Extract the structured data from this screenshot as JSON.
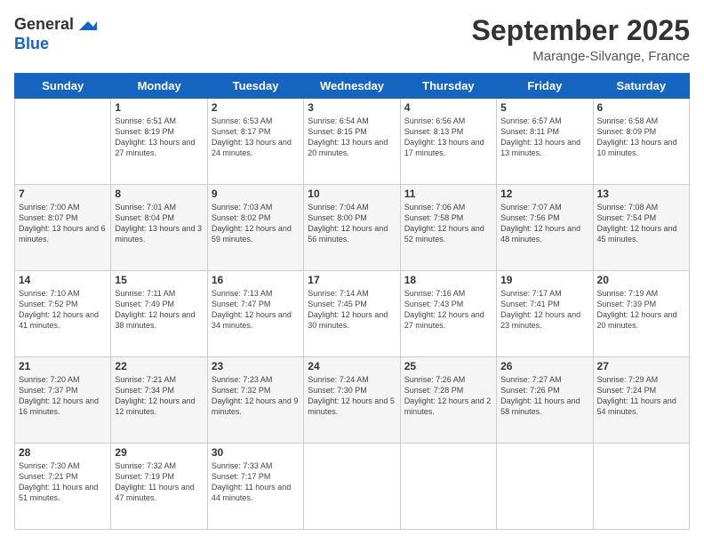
{
  "header": {
    "logo_line1": "General",
    "logo_line2": "Blue",
    "month": "September 2025",
    "location": "Marange-Silvange, France"
  },
  "days_of_week": [
    "Sunday",
    "Monday",
    "Tuesday",
    "Wednesday",
    "Thursday",
    "Friday",
    "Saturday"
  ],
  "weeks": [
    [
      {
        "day": "",
        "sunrise": "",
        "sunset": "",
        "daylight": ""
      },
      {
        "day": "1",
        "sunrise": "Sunrise: 6:51 AM",
        "sunset": "Sunset: 8:19 PM",
        "daylight": "Daylight: 13 hours and 27 minutes."
      },
      {
        "day": "2",
        "sunrise": "Sunrise: 6:53 AM",
        "sunset": "Sunset: 8:17 PM",
        "daylight": "Daylight: 13 hours and 24 minutes."
      },
      {
        "day": "3",
        "sunrise": "Sunrise: 6:54 AM",
        "sunset": "Sunset: 8:15 PM",
        "daylight": "Daylight: 13 hours and 20 minutes."
      },
      {
        "day": "4",
        "sunrise": "Sunrise: 6:56 AM",
        "sunset": "Sunset: 8:13 PM",
        "daylight": "Daylight: 13 hours and 17 minutes."
      },
      {
        "day": "5",
        "sunrise": "Sunrise: 6:57 AM",
        "sunset": "Sunset: 8:11 PM",
        "daylight": "Daylight: 13 hours and 13 minutes."
      },
      {
        "day": "6",
        "sunrise": "Sunrise: 6:58 AM",
        "sunset": "Sunset: 8:09 PM",
        "daylight": "Daylight: 13 hours and 10 minutes."
      }
    ],
    [
      {
        "day": "7",
        "sunrise": "Sunrise: 7:00 AM",
        "sunset": "Sunset: 8:07 PM",
        "daylight": "Daylight: 13 hours and 6 minutes."
      },
      {
        "day": "8",
        "sunrise": "Sunrise: 7:01 AM",
        "sunset": "Sunset: 8:04 PM",
        "daylight": "Daylight: 13 hours and 3 minutes."
      },
      {
        "day": "9",
        "sunrise": "Sunrise: 7:03 AM",
        "sunset": "Sunset: 8:02 PM",
        "daylight": "Daylight: 12 hours and 59 minutes."
      },
      {
        "day": "10",
        "sunrise": "Sunrise: 7:04 AM",
        "sunset": "Sunset: 8:00 PM",
        "daylight": "Daylight: 12 hours and 56 minutes."
      },
      {
        "day": "11",
        "sunrise": "Sunrise: 7:06 AM",
        "sunset": "Sunset: 7:58 PM",
        "daylight": "Daylight: 12 hours and 52 minutes."
      },
      {
        "day": "12",
        "sunrise": "Sunrise: 7:07 AM",
        "sunset": "Sunset: 7:56 PM",
        "daylight": "Daylight: 12 hours and 48 minutes."
      },
      {
        "day": "13",
        "sunrise": "Sunrise: 7:08 AM",
        "sunset": "Sunset: 7:54 PM",
        "daylight": "Daylight: 12 hours and 45 minutes."
      }
    ],
    [
      {
        "day": "14",
        "sunrise": "Sunrise: 7:10 AM",
        "sunset": "Sunset: 7:52 PM",
        "daylight": "Daylight: 12 hours and 41 minutes."
      },
      {
        "day": "15",
        "sunrise": "Sunrise: 7:11 AM",
        "sunset": "Sunset: 7:49 PM",
        "daylight": "Daylight: 12 hours and 38 minutes."
      },
      {
        "day": "16",
        "sunrise": "Sunrise: 7:13 AM",
        "sunset": "Sunset: 7:47 PM",
        "daylight": "Daylight: 12 hours and 34 minutes."
      },
      {
        "day": "17",
        "sunrise": "Sunrise: 7:14 AM",
        "sunset": "Sunset: 7:45 PM",
        "daylight": "Daylight: 12 hours and 30 minutes."
      },
      {
        "day": "18",
        "sunrise": "Sunrise: 7:16 AM",
        "sunset": "Sunset: 7:43 PM",
        "daylight": "Daylight: 12 hours and 27 minutes."
      },
      {
        "day": "19",
        "sunrise": "Sunrise: 7:17 AM",
        "sunset": "Sunset: 7:41 PM",
        "daylight": "Daylight: 12 hours and 23 minutes."
      },
      {
        "day": "20",
        "sunrise": "Sunrise: 7:19 AM",
        "sunset": "Sunset: 7:39 PM",
        "daylight": "Daylight: 12 hours and 20 minutes."
      }
    ],
    [
      {
        "day": "21",
        "sunrise": "Sunrise: 7:20 AM",
        "sunset": "Sunset: 7:37 PM",
        "daylight": "Daylight: 12 hours and 16 minutes."
      },
      {
        "day": "22",
        "sunrise": "Sunrise: 7:21 AM",
        "sunset": "Sunset: 7:34 PM",
        "daylight": "Daylight: 12 hours and 12 minutes."
      },
      {
        "day": "23",
        "sunrise": "Sunrise: 7:23 AM",
        "sunset": "Sunset: 7:32 PM",
        "daylight": "Daylight: 12 hours and 9 minutes."
      },
      {
        "day": "24",
        "sunrise": "Sunrise: 7:24 AM",
        "sunset": "Sunset: 7:30 PM",
        "daylight": "Daylight: 12 hours and 5 minutes."
      },
      {
        "day": "25",
        "sunrise": "Sunrise: 7:26 AM",
        "sunset": "Sunset: 7:28 PM",
        "daylight": "Daylight: 12 hours and 2 minutes."
      },
      {
        "day": "26",
        "sunrise": "Sunrise: 7:27 AM",
        "sunset": "Sunset: 7:26 PM",
        "daylight": "Daylight: 11 hours and 58 minutes."
      },
      {
        "day": "27",
        "sunrise": "Sunrise: 7:29 AM",
        "sunset": "Sunset: 7:24 PM",
        "daylight": "Daylight: 11 hours and 54 minutes."
      }
    ],
    [
      {
        "day": "28",
        "sunrise": "Sunrise: 7:30 AM",
        "sunset": "Sunset: 7:21 PM",
        "daylight": "Daylight: 11 hours and 51 minutes."
      },
      {
        "day": "29",
        "sunrise": "Sunrise: 7:32 AM",
        "sunset": "Sunset: 7:19 PM",
        "daylight": "Daylight: 11 hours and 47 minutes."
      },
      {
        "day": "30",
        "sunrise": "Sunrise: 7:33 AM",
        "sunset": "Sunset: 7:17 PM",
        "daylight": "Daylight: 11 hours and 44 minutes."
      },
      {
        "day": "",
        "sunrise": "",
        "sunset": "",
        "daylight": ""
      },
      {
        "day": "",
        "sunrise": "",
        "sunset": "",
        "daylight": ""
      },
      {
        "day": "",
        "sunrise": "",
        "sunset": "",
        "daylight": ""
      },
      {
        "day": "",
        "sunrise": "",
        "sunset": "",
        "daylight": ""
      }
    ]
  ]
}
